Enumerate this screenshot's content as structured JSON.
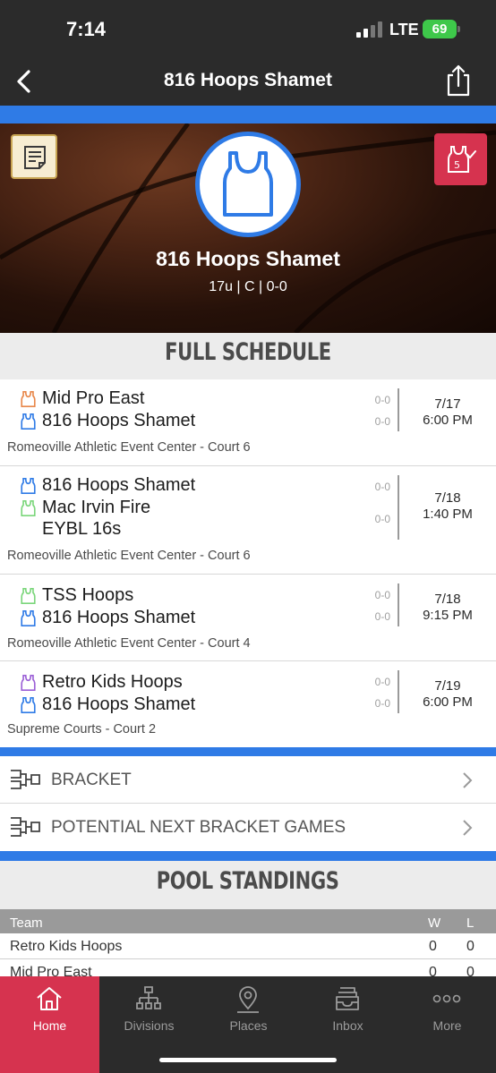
{
  "status_bar": {
    "time": "7:14",
    "network": "LTE",
    "battery": "69"
  },
  "nav": {
    "title": "816 Hoops Shamet"
  },
  "team": {
    "name": "816 Hoops Shamet",
    "meta": "17u | C | 0-0",
    "vote_badge": "5"
  },
  "schedule": {
    "heading": "FULL SCHEDULE",
    "games": [
      {
        "team1": "Mid Pro East",
        "team1_color": "#e8874a",
        "score1": "0-0",
        "team2": "816 Hoops Shamet",
        "team2_color": "#2f7be6",
        "score2": "0-0",
        "date": "7/17",
        "time": "6:00 PM",
        "venue": "Romeoville Athletic Event Center - Court 6"
      },
      {
        "team1": "816 Hoops Shamet",
        "team1_color": "#2f7be6",
        "score1": "0-0",
        "team2_line1": "Mac Irvin Fire",
        "team2_line2": "EYBL 16s",
        "team2_color": "#7bd67b",
        "score2": "0-0",
        "date": "7/18",
        "time": "1:40 PM",
        "venue": "Romeoville Athletic Event Center - Court 6"
      },
      {
        "team1": "TSS Hoops",
        "team1_color": "#7bd67b",
        "score1": "0-0",
        "team2": "816 Hoops Shamet",
        "team2_color": "#2f7be6",
        "score2": "0-0",
        "date": "7/18",
        "time": "9:15 PM",
        "venue": "Romeoville Athletic Event Center - Court 4"
      },
      {
        "team1": "Retro Kids Hoops",
        "team1_color": "#9b5fd6",
        "score1": "0-0",
        "team2": "816 Hoops Shamet",
        "team2_color": "#2f7be6",
        "score2": "0-0",
        "date": "7/19",
        "time": "6:00 PM",
        "venue": "Supreme Courts - Court 2"
      }
    ]
  },
  "bracket_links": [
    {
      "label": "BRACKET"
    },
    {
      "label": "POTENTIAL NEXT BRACKET GAMES"
    }
  ],
  "standings": {
    "heading": "POOL STANDINGS",
    "columns": {
      "team": "Team",
      "wins": "W",
      "losses": "L"
    },
    "rows": [
      {
        "team": "Retro Kids Hoops",
        "w": "0",
        "l": "0"
      },
      {
        "team": "Mid Pro East",
        "w": "0",
        "l": "0"
      }
    ]
  },
  "tabs": [
    {
      "label": "Home",
      "icon": "home-icon",
      "active": true
    },
    {
      "label": "Divisions",
      "icon": "divisions-icon",
      "active": false
    },
    {
      "label": "Places",
      "icon": "location-pin-icon",
      "active": false
    },
    {
      "label": "Inbox",
      "icon": "inbox-icon",
      "active": false
    },
    {
      "label": "More",
      "icon": "more-icon",
      "active": false
    }
  ],
  "colors": {
    "accent_blue": "#2f7be6",
    "active_tab": "#d6334f",
    "bar_dark": "#2b2b2b"
  }
}
